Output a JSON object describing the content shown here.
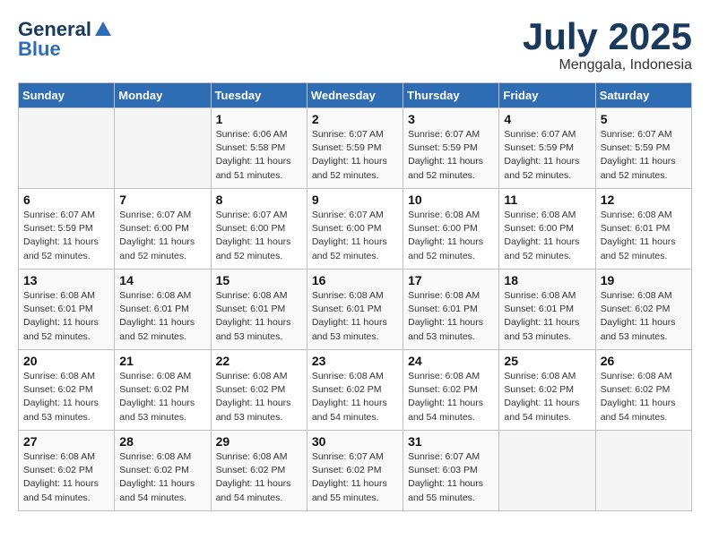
{
  "header": {
    "logo_general": "General",
    "logo_blue": "Blue",
    "month_title": "July 2025",
    "subtitle": "Menggala, Indonesia"
  },
  "days_of_week": [
    "Sunday",
    "Monday",
    "Tuesday",
    "Wednesday",
    "Thursday",
    "Friday",
    "Saturday"
  ],
  "weeks": [
    [
      {
        "day": "",
        "info": ""
      },
      {
        "day": "",
        "info": ""
      },
      {
        "day": "1",
        "info": "Sunrise: 6:06 AM\nSunset: 5:58 PM\nDaylight: 11 hours and 51 minutes."
      },
      {
        "day": "2",
        "info": "Sunrise: 6:07 AM\nSunset: 5:59 PM\nDaylight: 11 hours and 52 minutes."
      },
      {
        "day": "3",
        "info": "Sunrise: 6:07 AM\nSunset: 5:59 PM\nDaylight: 11 hours and 52 minutes."
      },
      {
        "day": "4",
        "info": "Sunrise: 6:07 AM\nSunset: 5:59 PM\nDaylight: 11 hours and 52 minutes."
      },
      {
        "day": "5",
        "info": "Sunrise: 6:07 AM\nSunset: 5:59 PM\nDaylight: 11 hours and 52 minutes."
      }
    ],
    [
      {
        "day": "6",
        "info": "Sunrise: 6:07 AM\nSunset: 5:59 PM\nDaylight: 11 hours and 52 minutes."
      },
      {
        "day": "7",
        "info": "Sunrise: 6:07 AM\nSunset: 6:00 PM\nDaylight: 11 hours and 52 minutes."
      },
      {
        "day": "8",
        "info": "Sunrise: 6:07 AM\nSunset: 6:00 PM\nDaylight: 11 hours and 52 minutes."
      },
      {
        "day": "9",
        "info": "Sunrise: 6:07 AM\nSunset: 6:00 PM\nDaylight: 11 hours and 52 minutes."
      },
      {
        "day": "10",
        "info": "Sunrise: 6:08 AM\nSunset: 6:00 PM\nDaylight: 11 hours and 52 minutes."
      },
      {
        "day": "11",
        "info": "Sunrise: 6:08 AM\nSunset: 6:00 PM\nDaylight: 11 hours and 52 minutes."
      },
      {
        "day": "12",
        "info": "Sunrise: 6:08 AM\nSunset: 6:01 PM\nDaylight: 11 hours and 52 minutes."
      }
    ],
    [
      {
        "day": "13",
        "info": "Sunrise: 6:08 AM\nSunset: 6:01 PM\nDaylight: 11 hours and 52 minutes."
      },
      {
        "day": "14",
        "info": "Sunrise: 6:08 AM\nSunset: 6:01 PM\nDaylight: 11 hours and 52 minutes."
      },
      {
        "day": "15",
        "info": "Sunrise: 6:08 AM\nSunset: 6:01 PM\nDaylight: 11 hours and 53 minutes."
      },
      {
        "day": "16",
        "info": "Sunrise: 6:08 AM\nSunset: 6:01 PM\nDaylight: 11 hours and 53 minutes."
      },
      {
        "day": "17",
        "info": "Sunrise: 6:08 AM\nSunset: 6:01 PM\nDaylight: 11 hours and 53 minutes."
      },
      {
        "day": "18",
        "info": "Sunrise: 6:08 AM\nSunset: 6:01 PM\nDaylight: 11 hours and 53 minutes."
      },
      {
        "day": "19",
        "info": "Sunrise: 6:08 AM\nSunset: 6:02 PM\nDaylight: 11 hours and 53 minutes."
      }
    ],
    [
      {
        "day": "20",
        "info": "Sunrise: 6:08 AM\nSunset: 6:02 PM\nDaylight: 11 hours and 53 minutes."
      },
      {
        "day": "21",
        "info": "Sunrise: 6:08 AM\nSunset: 6:02 PM\nDaylight: 11 hours and 53 minutes."
      },
      {
        "day": "22",
        "info": "Sunrise: 6:08 AM\nSunset: 6:02 PM\nDaylight: 11 hours and 53 minutes."
      },
      {
        "day": "23",
        "info": "Sunrise: 6:08 AM\nSunset: 6:02 PM\nDaylight: 11 hours and 54 minutes."
      },
      {
        "day": "24",
        "info": "Sunrise: 6:08 AM\nSunset: 6:02 PM\nDaylight: 11 hours and 54 minutes."
      },
      {
        "day": "25",
        "info": "Sunrise: 6:08 AM\nSunset: 6:02 PM\nDaylight: 11 hours and 54 minutes."
      },
      {
        "day": "26",
        "info": "Sunrise: 6:08 AM\nSunset: 6:02 PM\nDaylight: 11 hours and 54 minutes."
      }
    ],
    [
      {
        "day": "27",
        "info": "Sunrise: 6:08 AM\nSunset: 6:02 PM\nDaylight: 11 hours and 54 minutes."
      },
      {
        "day": "28",
        "info": "Sunrise: 6:08 AM\nSunset: 6:02 PM\nDaylight: 11 hours and 54 minutes."
      },
      {
        "day": "29",
        "info": "Sunrise: 6:08 AM\nSunset: 6:02 PM\nDaylight: 11 hours and 54 minutes."
      },
      {
        "day": "30",
        "info": "Sunrise: 6:07 AM\nSunset: 6:02 PM\nDaylight: 11 hours and 55 minutes."
      },
      {
        "day": "31",
        "info": "Sunrise: 6:07 AM\nSunset: 6:03 PM\nDaylight: 11 hours and 55 minutes."
      },
      {
        "day": "",
        "info": ""
      },
      {
        "day": "",
        "info": ""
      }
    ]
  ]
}
